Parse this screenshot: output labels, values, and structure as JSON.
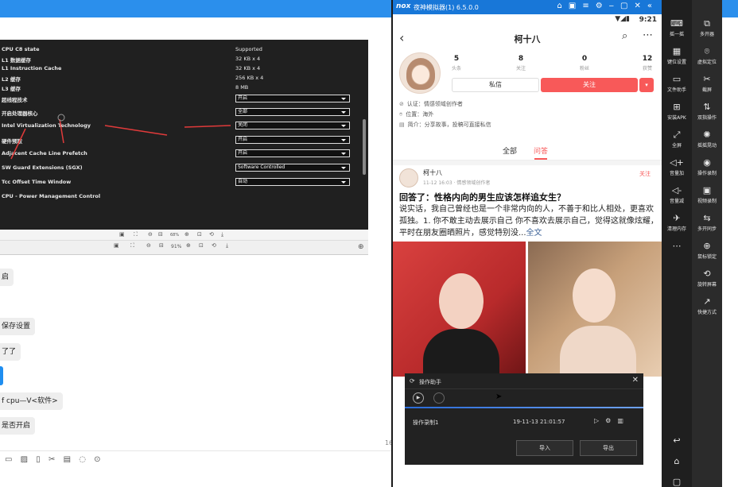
{
  "bios": {
    "rows": [
      {
        "label": "CPU C8 state",
        "value": "Supported",
        "select": false
      },
      {
        "label": "L1 数据缓存",
        "value": "32 KB x 4",
        "select": false
      },
      {
        "label": "L1 Instruction Cache",
        "value": "32 KB x 4",
        "select": false
      },
      {
        "label": "L2 缓存",
        "value": "256 KB x 4",
        "select": false
      },
      {
        "label": "L3 缓存",
        "value": "8 MB",
        "select": false
      },
      {
        "label": "超线程技术",
        "value": "开启",
        "select": true
      },
      {
        "label": "开启处理器核心",
        "value": "全部",
        "select": true
      },
      {
        "label": "Intel Virtualization Technology",
        "value": "关闭",
        "select": true
      },
      {
        "label": "硬件预取",
        "value": "开启",
        "select": true
      },
      {
        "label": "Adjacent Cache Line Prefetch",
        "value": "开启",
        "select": true
      },
      {
        "label": "SW Guard Extensions (SGX)",
        "value": "Software Controlled",
        "select": true
      },
      {
        "label": "Tcc Offset Time Window",
        "value": "自动",
        "select": true
      },
      {
        "label": "CPU - Power Management Control",
        "value": "",
        "select": false
      }
    ],
    "toolbar1_zoom": "68%",
    "toolbar2_zoom": "91%"
  },
  "chat": {
    "bubbles": [
      "启",
      "保存设置",
      "了了",
      "f cpu—V<软件>",
      "是否开启"
    ],
    "page_num": "16"
  },
  "emulator": {
    "title": "夜神模拟器(1) 6.5.0.0",
    "logo": "nox",
    "time": "9:21"
  },
  "profile": {
    "name": "柯十八",
    "stats": [
      {
        "num": "5",
        "label": "头条"
      },
      {
        "num": "8",
        "label": "关注"
      },
      {
        "num": "0",
        "label": "粉丝"
      },
      {
        "num": "12",
        "label": "获赞"
      }
    ],
    "message_btn": "私信",
    "follow_btn": "关注",
    "cert": "认证：情感领域创作者",
    "location": "位置：海外",
    "bio": "简介：分享故事，投稿可直接私信",
    "tabs": [
      "全部",
      "问答"
    ]
  },
  "post": {
    "author": "柯十八",
    "meta": "11-12 16:03 · 情感领域创作者",
    "follow": "关注",
    "title": "回答了：性格内向的男生应该怎样追女生？",
    "body": "说实话，我自己曾经也是一个非常内向的人，不善于和比人相处，更喜欢孤独。1. 你不敢主动去展示自己 你不喜欢去展示自己，觉得这就像炫耀，平时在朋友圈晒照片，感觉特别没...",
    "full": "全文"
  },
  "helper": {
    "title": "操作助手",
    "item": "操作录制1",
    "date": "19-11-13 21:01:57",
    "import": "导入",
    "export": "导出"
  },
  "side_left": [
    {
      "icon": "keyboard-icon",
      "glyph": "⌨",
      "label": "摇一摇"
    },
    {
      "icon": "keymap-icon",
      "glyph": "▦",
      "label": "键位设置"
    },
    {
      "icon": "file-icon",
      "glyph": "▭",
      "label": "文件助手"
    },
    {
      "icon": "apk-icon",
      "glyph": "⊞",
      "label": "安装APK"
    },
    {
      "icon": "fullscreen-icon",
      "glyph": "⤢",
      "label": "全屏"
    },
    {
      "icon": "volume-up-icon",
      "glyph": "◁+",
      "label": "音量加"
    },
    {
      "icon": "volume-down-icon",
      "glyph": "◁-",
      "label": "音量减"
    },
    {
      "icon": "clean-icon",
      "glyph": "✈",
      "label": "清理内存"
    },
    {
      "icon": "more-icon",
      "glyph": "⋯",
      "label": ""
    }
  ],
  "side_right": [
    {
      "icon": "multi-open-icon",
      "glyph": "⧉",
      "label": "多开器"
    },
    {
      "icon": "location-icon",
      "glyph": "⌾",
      "label": "虚拟定位"
    },
    {
      "icon": "screenshot-icon",
      "glyph": "✂",
      "label": "截屏"
    },
    {
      "icon": "sync-icon",
      "glyph": "⇅",
      "label": "双指操作"
    },
    {
      "icon": "sync-op-icon",
      "glyph": "✺",
      "label": "摇摇晃动"
    },
    {
      "icon": "record-icon",
      "glyph": "◉",
      "label": "操作录制"
    },
    {
      "icon": "video-icon",
      "glyph": "▣",
      "label": "视频录制"
    },
    {
      "icon": "multi-sync-icon",
      "glyph": "⇆",
      "label": "多开同步"
    },
    {
      "icon": "crosshair-icon",
      "glyph": "⊕",
      "label": "鼠标锁定"
    },
    {
      "icon": "rotate-icon",
      "glyph": "⟲",
      "label": "旋转屏幕"
    },
    {
      "icon": "shortcut-icon",
      "glyph": "↗",
      "label": "快捷方式"
    }
  ],
  "nav_bottom": [
    "↩",
    "⌂",
    "▢"
  ]
}
